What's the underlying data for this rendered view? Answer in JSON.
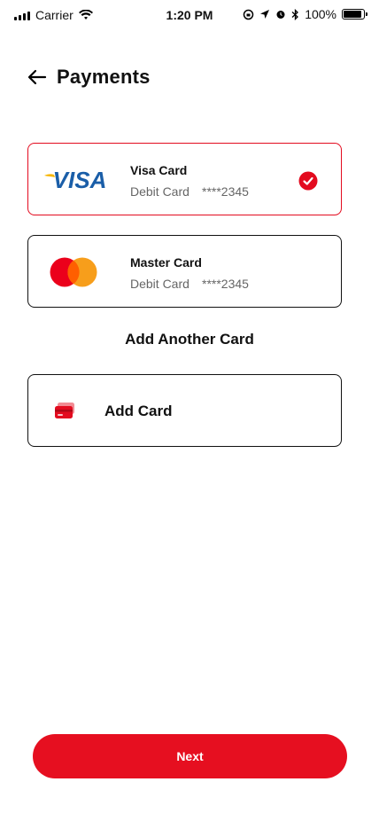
{
  "status_bar": {
    "carrier": "Carrier",
    "time": "1:20 PM",
    "battery": "100%",
    "battery_level": 1.0
  },
  "header": {
    "title": "Payments",
    "back_icon": "arrow-left-icon"
  },
  "cards": [
    {
      "name": "Visa Card",
      "type": "Debit Card",
      "number": "****2345",
      "brand": "VISA",
      "selected": true
    },
    {
      "name": "Master Card",
      "type": "Debit Card",
      "number": "****2345",
      "brand": "mastercard",
      "selected": false
    }
  ],
  "add_section": {
    "title": "Add Another Card",
    "add_label": "Add Card",
    "icon": "credit-card-icon"
  },
  "next_button": {
    "label": "Next"
  },
  "colors": {
    "accent": "#e30b1f",
    "visa_blue": "#1a5ea8",
    "visa_gold": "#f7b600",
    "mastercard_red": "#eb001b",
    "mastercard_orange": "#f79e1b"
  }
}
